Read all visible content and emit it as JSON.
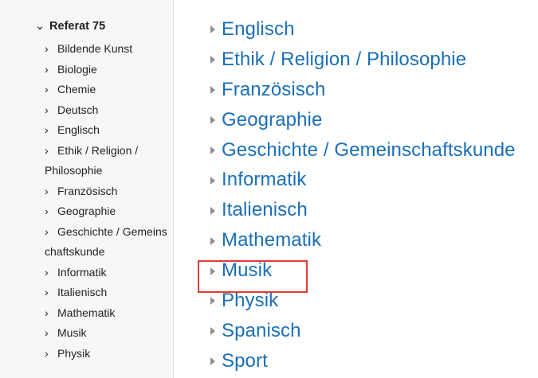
{
  "sidebar": {
    "heading": "Referat 75",
    "heading_icon": "chevron-down-icon",
    "item_icon": "chevron-right-icon",
    "items": [
      {
        "label": "Bildende Kunst"
      },
      {
        "label": "Biologie"
      },
      {
        "label": "Chemie"
      },
      {
        "label": "Deutsch"
      },
      {
        "label": "Englisch"
      },
      {
        "label": "Ethik / Religion / Philosophie"
      },
      {
        "label": "Französisch"
      },
      {
        "label": "Geographie"
      },
      {
        "label": "Geschichte / Gemeinschaftskunde"
      },
      {
        "label": "Informatik"
      },
      {
        "label": "Italienisch"
      },
      {
        "label": "Mathematik"
      },
      {
        "label": "Musik"
      },
      {
        "label": "Physik"
      }
    ]
  },
  "main": {
    "expand_icon": "triangle-right-icon",
    "items": [
      {
        "label": "Englisch"
      },
      {
        "label": "Ethik / Religion / Philosophie"
      },
      {
        "label": "Französisch"
      },
      {
        "label": "Geographie"
      },
      {
        "label": "Geschichte / Gemeinschaftskunde"
      },
      {
        "label": "Informatik"
      },
      {
        "label": "Italienisch"
      },
      {
        "label": "Mathematik"
      },
      {
        "label": "Musik"
      },
      {
        "label": "Physik"
      },
      {
        "label": "Spanisch"
      },
      {
        "label": "Sport"
      }
    ],
    "highlighted": "Musik"
  },
  "colors": {
    "link": "#1a6fb7",
    "highlight_border": "#e53935",
    "sidebar_bg": "#f7f7f7"
  }
}
